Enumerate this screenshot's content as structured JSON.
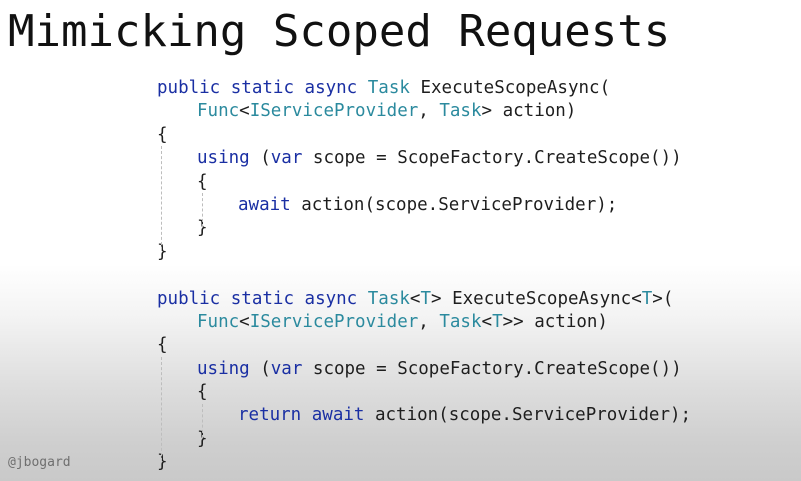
{
  "slide": {
    "title": "Mimicking Scoped Requests",
    "handle": "@jbogard"
  },
  "colors": {
    "keyword": "#1a2fa3",
    "type": "#2b8a9e",
    "text": "#1e1e1e"
  },
  "code": {
    "method1": {
      "kw_public": "public",
      "kw_static": "static",
      "kw_async": "async",
      "ret_type": "Task",
      "name": "ExecuteScopeAsync(",
      "param_func": "Func",
      "lt": "<",
      "param_provider": "IServiceProvider",
      "comma": ", ",
      "param_task": "Task",
      "param_rest": "> action)",
      "open_brace": "{",
      "kw_using": "using",
      "paren_open": " (",
      "kw_var": "var",
      "using_rest": " scope = ScopeFactory.CreateScope())",
      "inner_open": "{",
      "kw_await": "await",
      "await_rest": " action(scope.ServiceProvider);",
      "inner_close": "}",
      "close_brace": "}"
    },
    "method2": {
      "kw_public": "public",
      "kw_static": "static",
      "kw_async": "async",
      "ret_type": "Task",
      "ret_lt": "<",
      "ret_T": "T",
      "ret_gt": "> ",
      "name": "ExecuteScopeAsync<",
      "name_T": "T",
      "name_end": ">(",
      "param_func": "Func",
      "lt": "<",
      "param_provider": "IServiceProvider",
      "comma": ", ",
      "param_task": "Task",
      "param_lt": "<",
      "param_T": "T",
      "param_rest": ">> action)",
      "open_brace": "{",
      "kw_using": "using",
      "paren_open": " (",
      "kw_var": "var",
      "using_rest": " scope = ScopeFactory.CreateScope())",
      "inner_open": "{",
      "kw_return": "return",
      "kw_await": "await",
      "await_rest": " action(scope.ServiceProvider);",
      "inner_close": "}",
      "close_brace": "}"
    }
  }
}
